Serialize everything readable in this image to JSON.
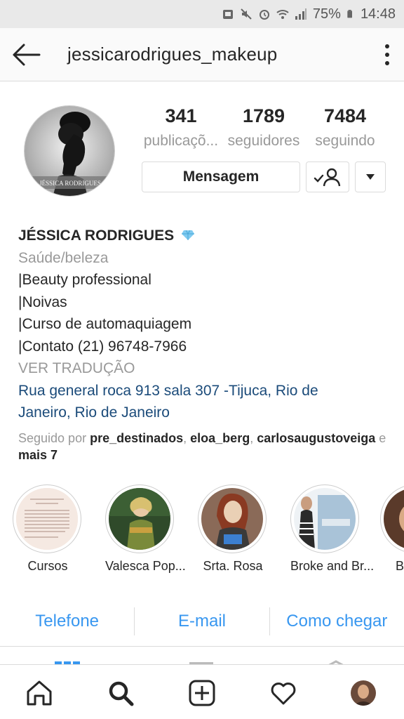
{
  "status_bar": {
    "battery": "75%",
    "time": "14:48"
  },
  "header": {
    "username": "jessicarodrigues_makeup"
  },
  "avatar": {
    "caption": "JÉSSICA RODRIGUES"
  },
  "stats": [
    {
      "value": "341",
      "label": "publicaçõ..."
    },
    {
      "value": "1789",
      "label": "seguidores"
    },
    {
      "value": "7484",
      "label": "seguindo"
    }
  ],
  "buttons": {
    "message_label": "Mensagem"
  },
  "bio": {
    "name": "JÉSSICA RODRIGUES",
    "category": "Saúde/beleza",
    "lines": [
      "|Beauty professional",
      "|Noivas",
      "|Curso de automaquiagem",
      "|Contato (21) 96748-7966"
    ],
    "translate": "VER TRADUÇÃO",
    "address_line1": "Rua general roca 913 sala 307 -Tijuca, Rio de",
    "address_line2": "Janeiro, Rio de Janeiro",
    "followed_prefix": "Seguido por",
    "followed_users": [
      "pre_destinados",
      "eloa_berg",
      "carlosaugustoveiga"
    ],
    "followed_suffix_e": "e",
    "followed_more": "mais 7"
  },
  "highlights": [
    {
      "label": "Cursos"
    },
    {
      "label": "Valesca Pop..."
    },
    {
      "label": "Srta. Rosa"
    },
    {
      "label": "Broke and Br..."
    },
    {
      "label": "B"
    }
  ],
  "actions": {
    "phone": "Telefone",
    "email": "E-mail",
    "directions": "Como chegar"
  },
  "colors": {
    "link_blue": "#3897f0",
    "address_blue": "#1b4b7a",
    "muted": "#999999"
  }
}
